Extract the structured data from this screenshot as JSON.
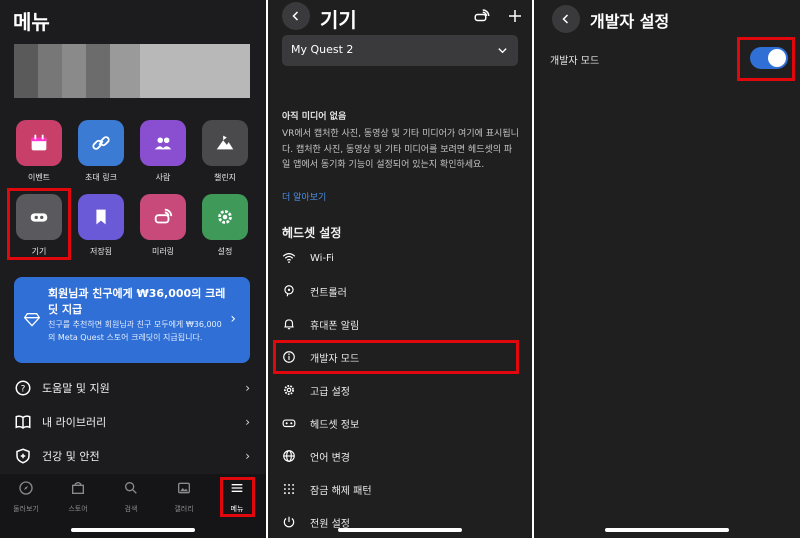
{
  "panel1": {
    "title": "메뉴",
    "apps": [
      {
        "label": "이벤트",
        "icon": "calendar-icon",
        "color": "#c8406a"
      },
      {
        "label": "초대 링크",
        "icon": "link-icon",
        "color": "#3b7bd4"
      },
      {
        "label": "사람",
        "icon": "people-icon",
        "color": "#8a4fd0"
      },
      {
        "label": "챌린지",
        "icon": "mountain-icon",
        "color": "#4a4a4c"
      },
      {
        "label": "기기",
        "icon": "headset-icon",
        "color": "#5a5a5e"
      },
      {
        "label": "저장됨",
        "icon": "bookmark-icon",
        "color": "#6a5ad8"
      },
      {
        "label": "미러링",
        "icon": "mirror-cast-icon",
        "color": "#c84a7a"
      },
      {
        "label": "설정",
        "icon": "gear-icon",
        "color": "#3f9a5a"
      }
    ],
    "promo": {
      "title": "회원님과 친구에게 ₩36,000의 크레딧 지급",
      "body": "친구를 추천하면 회원님과 친구 모두에게 ₩36,000의 Meta Quest 스토어 크레딧이 지급됩니다."
    },
    "menu_items": [
      {
        "label": "도움말 및 지원",
        "icon": "help-icon"
      },
      {
        "label": "내 라이브러리",
        "icon": "library-icon"
      },
      {
        "label": "건강 및 안전",
        "icon": "shield-icon"
      }
    ],
    "tabs": [
      {
        "label": "둘러보기",
        "icon": "compass-icon"
      },
      {
        "label": "스토어",
        "icon": "store-icon"
      },
      {
        "label": "검색",
        "icon": "search-icon"
      },
      {
        "label": "갤러리",
        "icon": "gallery-icon"
      },
      {
        "label": "메뉴",
        "icon": "menu-icon"
      }
    ],
    "active_tab": "메뉴"
  },
  "panel2": {
    "title": "기기",
    "device": "My Quest 2",
    "media_heading": "아직 미디어 없음",
    "media_body": "VR에서 캡처한 사진, 동영상 및 기타 미디어가 여기에 표시됩니다. 캡처한 사진, 동영상 및 기타 미디어를 보려면 헤드셋의 파일 앱에서 동기화 기능이 설정되어 있는지 확인하세요.",
    "media_link": "더 알아보기",
    "section_title": "헤드셋 설정",
    "settings": [
      {
        "label": "Wi-Fi",
        "icon": "wifi-icon"
      },
      {
        "label": "컨트롤러",
        "icon": "controller-icon"
      },
      {
        "label": "휴대폰 알림",
        "icon": "bell-icon"
      },
      {
        "label": "개발자 모드",
        "icon": "info-icon"
      },
      {
        "label": "고급 설정",
        "icon": "gear-icon"
      },
      {
        "label": "헤드셋 정보",
        "icon": "headset-icon"
      },
      {
        "label": "언어 변경",
        "icon": "globe-icon"
      },
      {
        "label": "잠금 해제 패턴",
        "icon": "pattern-icon"
      },
      {
        "label": "전원 설정",
        "icon": "power-icon"
      }
    ]
  },
  "panel3": {
    "title": "개발자 설정",
    "dev_mode_label": "개발자 모드",
    "dev_mode_on": true
  },
  "colors": {
    "highlight": "#e0080c",
    "accent": "#2f6fd6",
    "link": "#4c8fe8",
    "background": "#1c1c1e"
  }
}
